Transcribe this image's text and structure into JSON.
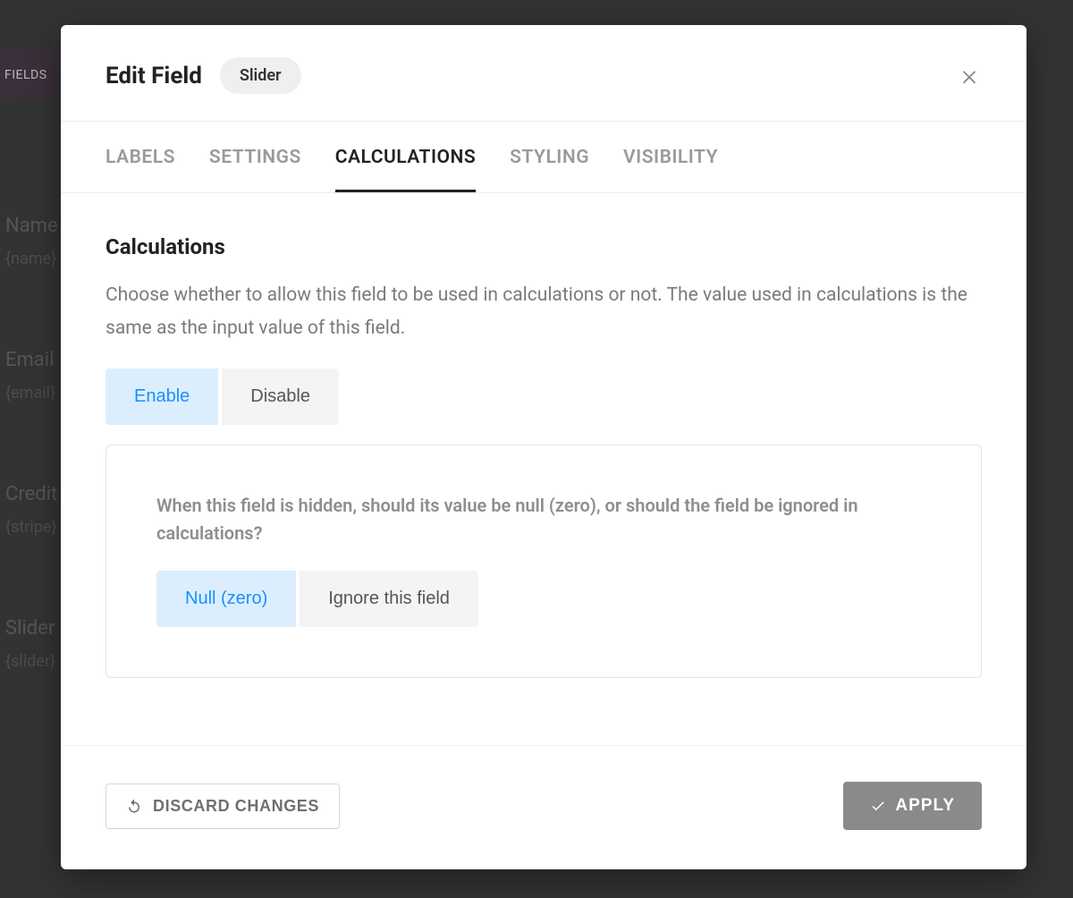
{
  "background": {
    "fields_tab": "FIELDS",
    "items": [
      {
        "label": "Name",
        "token": "{name}"
      },
      {
        "label": "Email",
        "token": "{email}"
      },
      {
        "label": "Credit",
        "token": "{stripe}"
      },
      {
        "label": "Slider",
        "token": "{slider}"
      }
    ]
  },
  "modal": {
    "title": "Edit Field",
    "type_pill": "Slider",
    "tabs": [
      {
        "label": "LABELS",
        "active": false
      },
      {
        "label": "SETTINGS",
        "active": false
      },
      {
        "label": "CALCULATIONS",
        "active": true
      },
      {
        "label": "STYLING",
        "active": false
      },
      {
        "label": "VISIBILITY",
        "active": false
      }
    ],
    "calculations": {
      "heading": "Calculations",
      "description": "Choose whether to allow this field to be used in calculations or not. The value used in calculations is the same as the input value of this field.",
      "enable_toggle": {
        "options": [
          "Enable",
          "Disable"
        ],
        "selected": "Enable"
      },
      "hidden_behavior": {
        "question": "When this field is hidden, should its value be null (zero), or should the field be ignored in calculations?",
        "options": [
          "Null (zero)",
          "Ignore this field"
        ],
        "selected": "Null (zero)"
      }
    },
    "footer": {
      "discard": "DISCARD CHANGES",
      "apply": "APPLY"
    }
  }
}
